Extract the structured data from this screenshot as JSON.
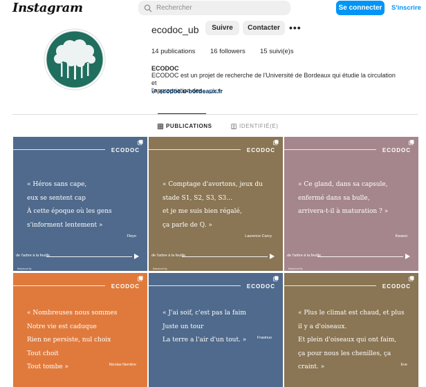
{
  "header": {
    "logo": "Instagram",
    "search_placeholder": "Rechercher",
    "connect_label": "Se connecter",
    "signup_label": "S'inscrire"
  },
  "profile": {
    "username": "ecodoc_ub",
    "follow_label": "Suivre",
    "contact_label": "Contacter",
    "more_label": "•••",
    "publications": "14 publications",
    "followers": "16 followers",
    "following": "15 suivi(e)s",
    "bio_name": "ECODOC",
    "bio_line1": "ECODOC est un projet de recherche de l'Université de Bordeaux qui étudie la circulation et",
    "bio_line2": "l'appropriation des...",
    "bio_more": "plus",
    "link": "ecodoc.u-bordeaux.fr"
  },
  "tabs": {
    "publications": "PUBLICATIONS",
    "identified": "IDENTIFIÉ(E)"
  },
  "posts": [
    {
      "color": "#4f6a8c",
      "brand": "ECODOC",
      "lines": [
        "« Héros sans cape,",
        "eux se sentent cap",
        "À cette époque où les gens",
        "s'informent lentement »"
      ],
      "author": "Fleyo",
      "tagline": "de l'arbre à la feuille",
      "small": "Babybook By"
    },
    {
      "color": "#8a7554",
      "brand": "ECODOC",
      "lines": [
        "« Comptage d'avortons, jeux du",
        "stade S1, S2, S3, S3…",
        "et je me suis bien régalé,",
        "ça parle de Q. »"
      ],
      "author": "Laurence Carcy",
      "tagline": "de l'arbre à la feuille",
      "small": "Babybook By"
    },
    {
      "color": "#a5868c",
      "brand": "ECODOC",
      "lines": [
        "« Ce gland, dans sa capsule,",
        "enfermé dans sa bulle,",
        "arrivera-t-il à maturation ? »"
      ],
      "author": "Kwassi",
      "tagline": "de l'arbre à la feuille",
      "small": "Babybook By"
    },
    {
      "color": "#e07a3c",
      "brand": "ECODOC",
      "lines": [
        "« Nombreuses nous sommes",
        "Notre vie est caduque",
        "Rien ne persiste, nul choix",
        "Tout choit",
        "Tout tombe »"
      ],
      "author": "Nicolas Nerrière",
      "tagline": "",
      "small": ""
    },
    {
      "color": "#4f6a8c",
      "brand": "ECODOC",
      "lines": [
        "« J'ai soif, c'est pas la faim",
        "Juste un tour",
        "La terre a l'air d'un tout. »"
      ],
      "author": "Frasinus",
      "tagline": "",
      "small": ""
    },
    {
      "color": "#8a7554",
      "brand": "ECODOC",
      "lines": [
        "« Plus le climat est chaud, et plus",
        "il y a d'oiseaux.",
        "Et plein d'oiseaux qui ont faim,",
        "ça pour nous les chenilles, ça",
        "craint. »"
      ],
      "author": "Eve",
      "tagline": "",
      "small": ""
    }
  ]
}
